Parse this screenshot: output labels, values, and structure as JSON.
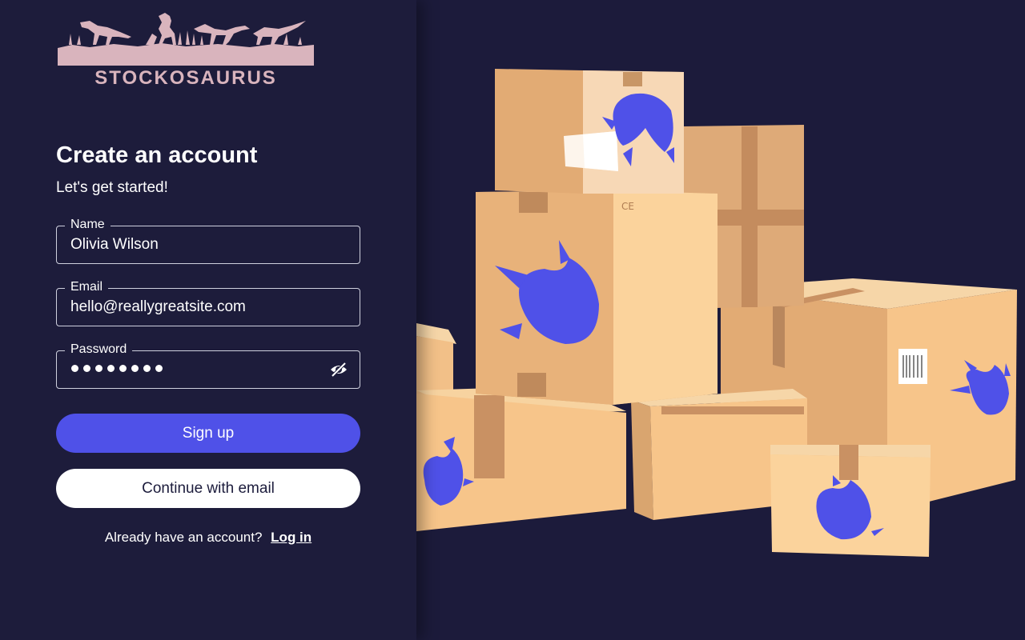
{
  "brand": {
    "name": "STOCKOSAURUS",
    "logo_color": "#d9b4bd"
  },
  "form": {
    "title": "Create an account",
    "subtitle": "Let's get started!",
    "name_label": "Name",
    "name_value": "Olivia Wilson",
    "email_label": "Email",
    "email_value": "hello@reallygreatsite.com",
    "password_label": "Password",
    "password_masked_length": 8,
    "password_toggle_icon": "eye-off-icon",
    "signup_label": "Sign up",
    "continue_label": "Continue with email",
    "footer_text": "Already have an account?",
    "login_label": "Log in"
  },
  "illustration": {
    "description_icon": "boxes-with-dino-footprints",
    "footprint_color": "#4f51e8",
    "box_color": "#f2c088"
  },
  "colors": {
    "background": "#1c1c3c",
    "accent": "#4f51e8",
    "text": "#ffffff"
  }
}
